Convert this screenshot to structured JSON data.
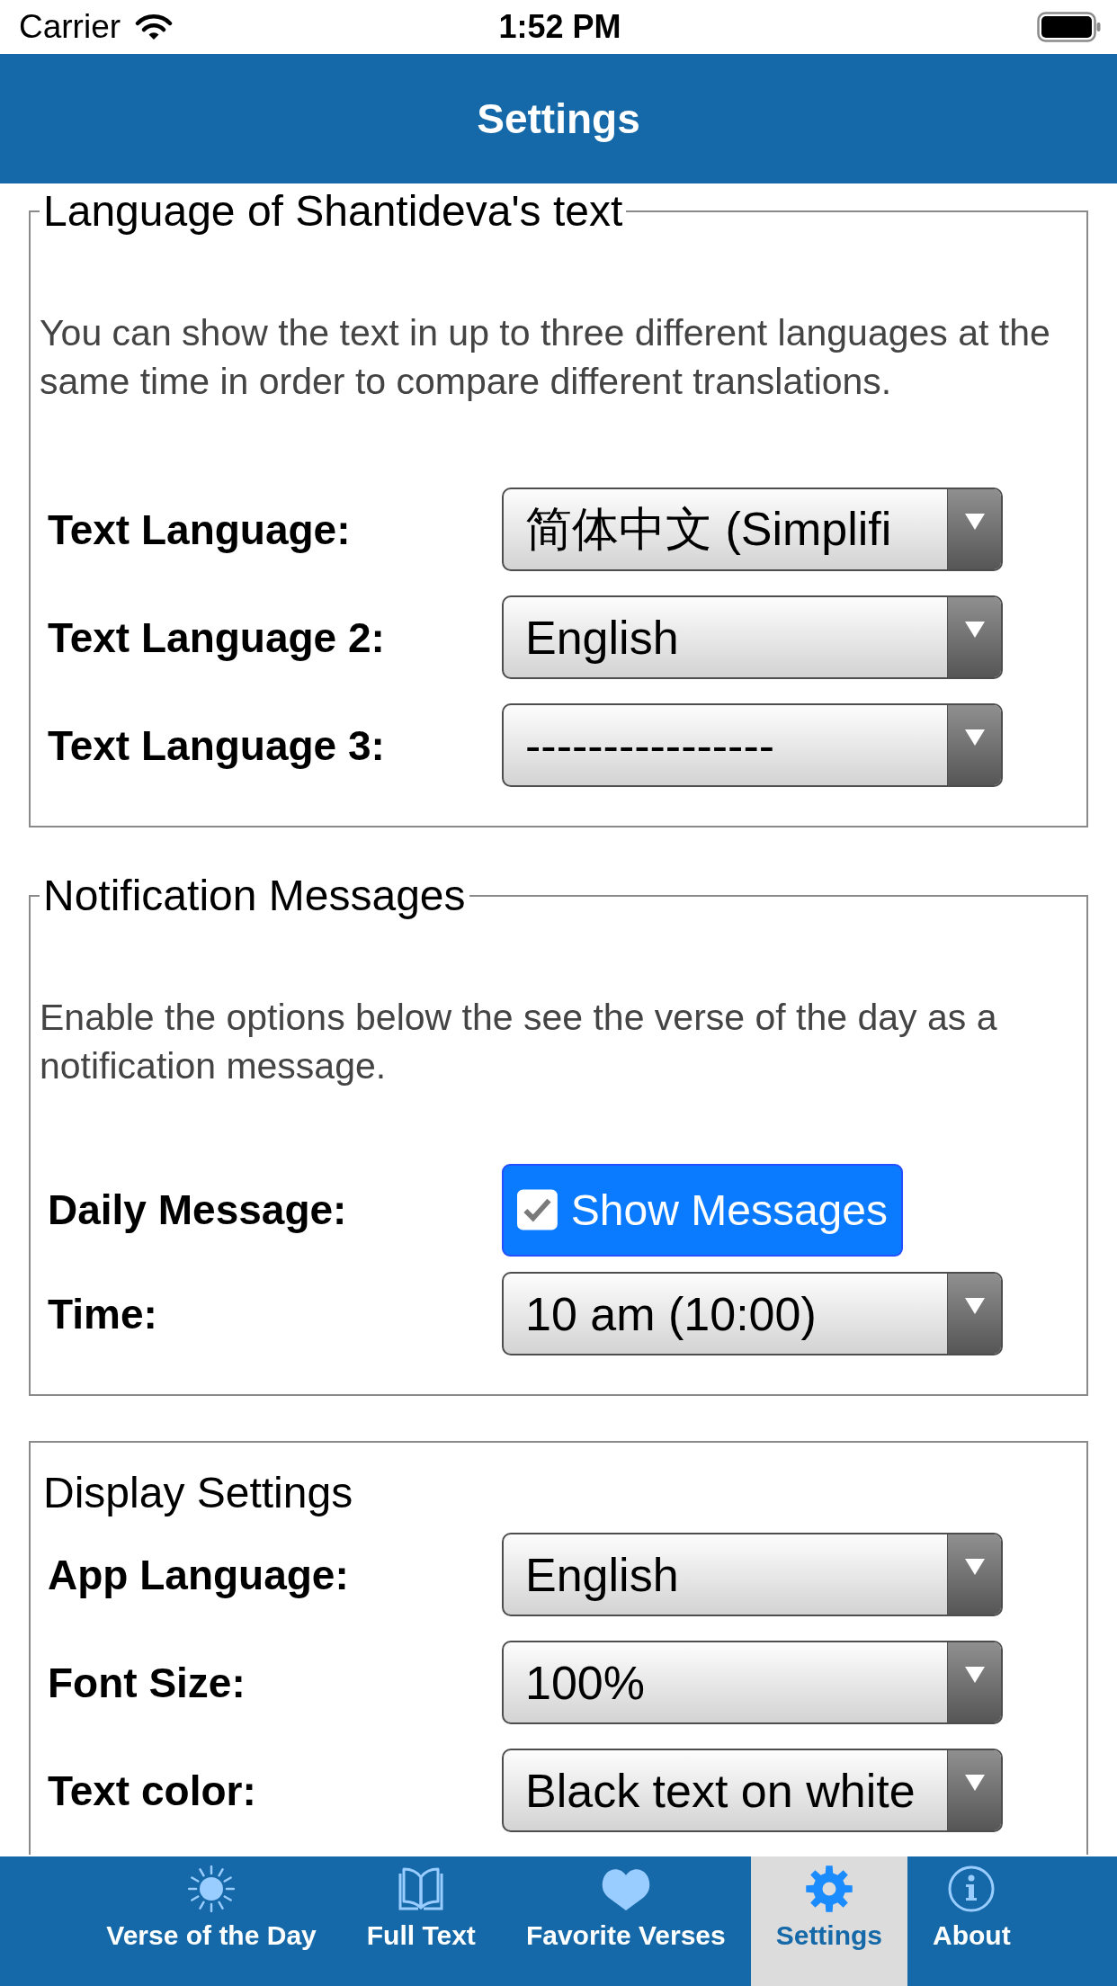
{
  "status_bar": {
    "carrier": "Carrier",
    "time": "1:52 PM"
  },
  "header": {
    "title": "Settings"
  },
  "sections": [
    {
      "kind": "fieldset",
      "title": "Language of Shantideva's text",
      "description": "You can show the text in up to three different languages at the same time in order to compare different translations.",
      "rows": [
        {
          "kind": "select",
          "label": "Text Language:",
          "value": "简体中文 (Simplifi"
        },
        {
          "kind": "select",
          "label": "Text Language 2:",
          "value": "English"
        },
        {
          "kind": "select",
          "label": "Text Language 3:",
          "value": "----------------"
        }
      ]
    },
    {
      "kind": "fieldset",
      "title": "Notification Messages",
      "description": "Enable the options below the see the verse of the day as a notification message.",
      "rows": [
        {
          "kind": "checkbox",
          "label": "Daily Message:",
          "text": "Show Messages",
          "checked": true
        },
        {
          "kind": "select",
          "label": "Time:",
          "value": "10 am (10:00)"
        }
      ]
    },
    {
      "kind": "panel",
      "title": "Display Settings",
      "rows": [
        {
          "kind": "select",
          "label": "App Language:",
          "value": "English"
        },
        {
          "kind": "select",
          "label": "Font Size:",
          "value": "100%"
        },
        {
          "kind": "select",
          "label": "Text color:",
          "value": "Black text on white"
        }
      ]
    }
  ],
  "tab_bar": [
    {
      "label": "Verse of the Day",
      "selected": false
    },
    {
      "label": "Full Text",
      "selected": false
    },
    {
      "label": "Favorite Verses",
      "selected": false
    },
    {
      "label": "Settings",
      "selected": true
    },
    {
      "label": "About",
      "selected": false
    }
  ]
}
